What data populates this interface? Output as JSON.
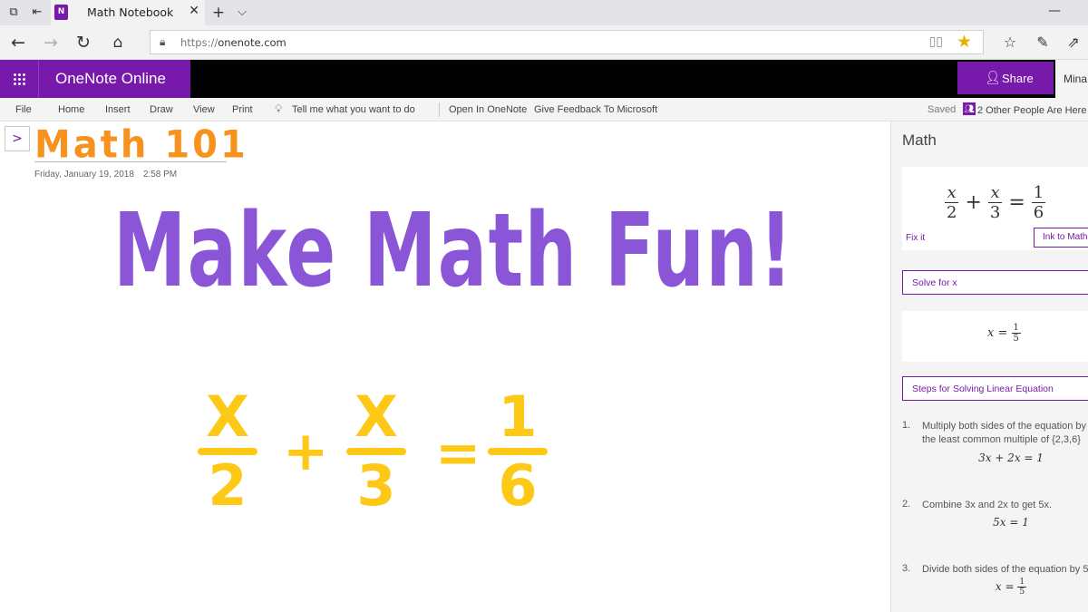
{
  "browser": {
    "tab_title": "Math Notebook",
    "tab_icon": "N",
    "tab_close": "✕",
    "new_tab": "+",
    "tab_list": "⌵",
    "minimize": "—",
    "url_scheme": "https://",
    "url_host": "onenote.com"
  },
  "app": {
    "name": "OneNote Online",
    "share_label": "Share",
    "user_name": "Mina",
    "accent_color": "#7719aa"
  },
  "ribbon": {
    "menus": [
      "File",
      "Home",
      "Insert",
      "Draw",
      "View",
      "Print"
    ],
    "tell_me": "Tell me what you want to do",
    "open_in": "Open In OneNote",
    "feedback": "Give Feedback To Microsoft",
    "saved": "Saved",
    "people": "2 Other People Are Here",
    "people_count": "2"
  },
  "page": {
    "title": "Math 101",
    "date": "Friday, January 19, 2018",
    "time": "2:58 PM",
    "ink_heading": "Make Math Fun!",
    "ink_equation": {
      "frac1_num": "X",
      "frac1_den": "2",
      "plus": "+",
      "frac2_num": "X",
      "frac2_den": "3",
      "equals": "=",
      "frac3_num": "1",
      "frac3_den": "6"
    },
    "heading_color": "#8a55d6",
    "title_color": "#f7921e",
    "equation_color": "#fdc916"
  },
  "math_pane": {
    "title": "Math",
    "equation": {
      "f1n": "x",
      "f1d": "2",
      "plus": "+",
      "f2n": "x",
      "f2d": "3",
      "eq": "=",
      "f3n": "1",
      "f3d": "6"
    },
    "fix_it": "Fix it",
    "ink_to_math": "Ink to Math",
    "action": "Solve for x",
    "answer": {
      "lhs": "x =",
      "num": "1",
      "den": "5"
    },
    "steps_title": "Steps for Solving Linear Equation",
    "steps": [
      {
        "num": "1.",
        "line1": "Multiply both sides of the equation by",
        "line2": "the least common multiple of {2,3,6}",
        "result": "3x + 2x = 1"
      },
      {
        "num": "2.",
        "line1": "Combine 3x and 2x to get 5x.",
        "result": "5x = 1"
      },
      {
        "num": "3.",
        "line1": "Divide both sides of the equation by 5",
        "result_lhs": "x =",
        "result_num": "1",
        "result_den": "5"
      }
    ]
  }
}
